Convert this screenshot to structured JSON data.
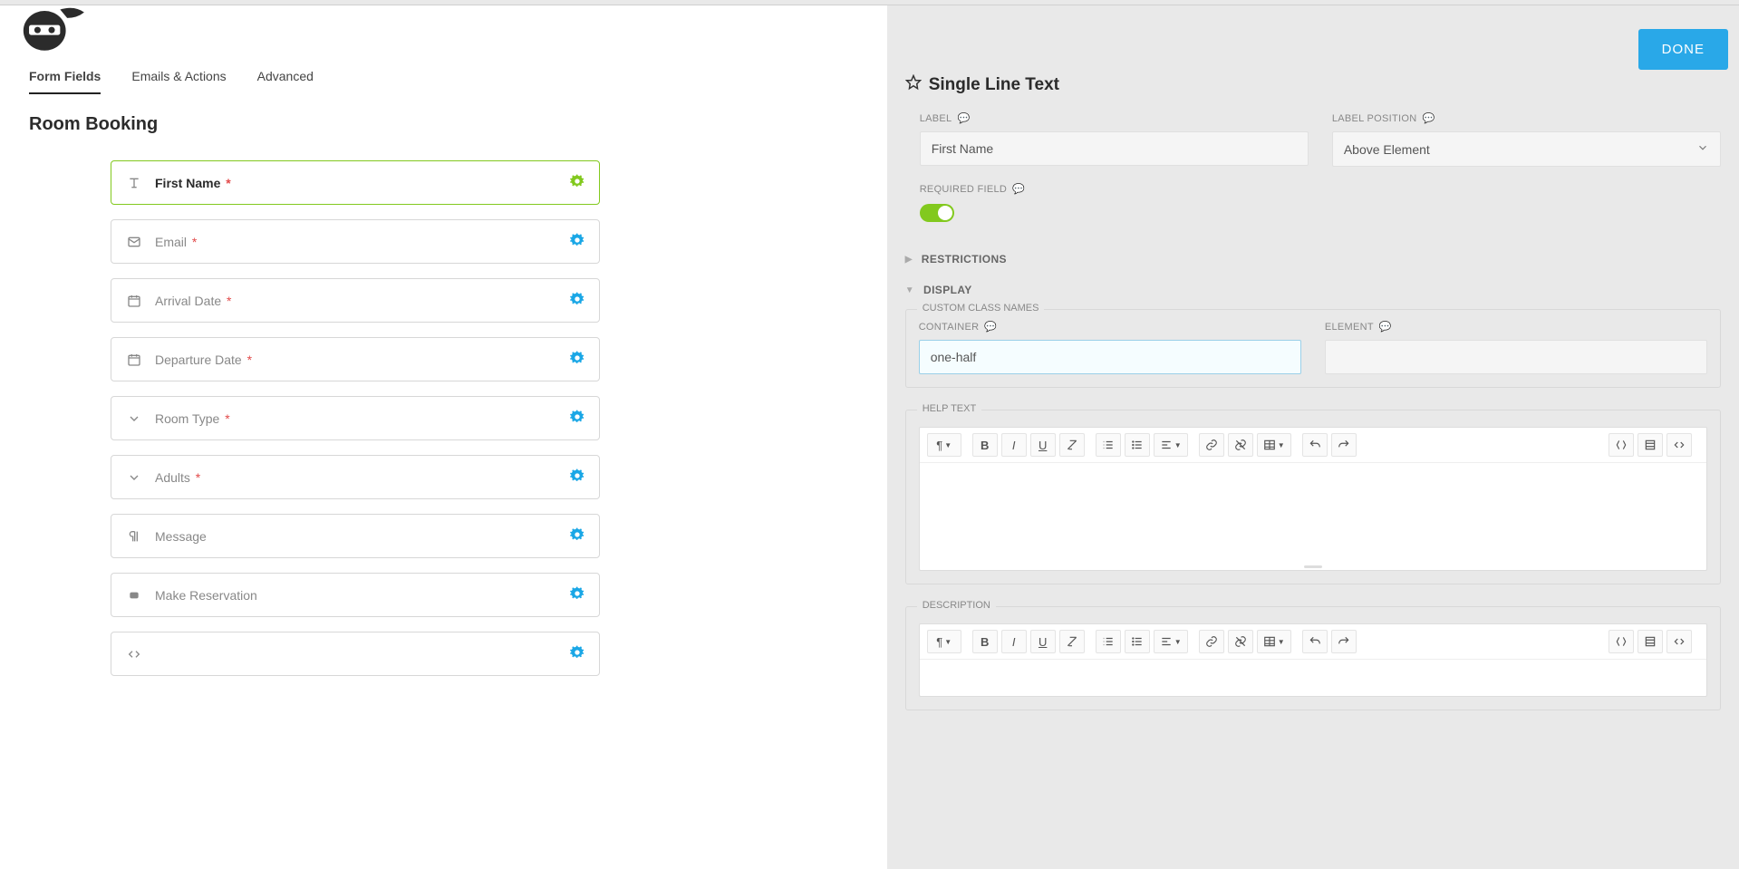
{
  "tabs": [
    "Form Fields",
    "Emails & Actions",
    "Advanced"
  ],
  "activeTab": 0,
  "formTitle": "Room Booking",
  "doneLabel": "DONE",
  "fields": [
    {
      "label": "First Name",
      "required": true,
      "icon": "text",
      "selected": true
    },
    {
      "label": "Email",
      "required": true,
      "icon": "mail",
      "selected": false
    },
    {
      "label": "Arrival Date",
      "required": true,
      "icon": "calendar",
      "selected": false
    },
    {
      "label": "Departure Date",
      "required": true,
      "icon": "calendar",
      "selected": false
    },
    {
      "label": "Room Type",
      "required": true,
      "icon": "dropdown",
      "selected": false
    },
    {
      "label": "Adults",
      "required": true,
      "icon": "dropdown",
      "selected": false
    },
    {
      "label": "Message",
      "required": false,
      "icon": "paragraph",
      "selected": false
    },
    {
      "label": "Make Reservation",
      "required": false,
      "icon": "button",
      "selected": false
    },
    {
      "label": "",
      "required": false,
      "icon": "code",
      "selected": false
    }
  ],
  "panel": {
    "title": "Single Line Text",
    "labelLabel": "LABEL",
    "labelValue": "First Name",
    "labelPositionLabel": "LABEL POSITION",
    "labelPositionValue": "Above Element",
    "requiredLabel": "REQUIRED FIELD",
    "requiredValue": true,
    "sections": {
      "restrictions": "RESTRICTIONS",
      "display": "DISPLAY"
    },
    "customClassLegend": "CUSTOM CLASS NAMES",
    "containerLabel": "CONTAINER",
    "containerValue": "one-half",
    "elementLabel": "ELEMENT",
    "elementValue": "",
    "helpTextLegend": "HELP TEXT",
    "descriptionLegend": "DESCRIPTION"
  }
}
